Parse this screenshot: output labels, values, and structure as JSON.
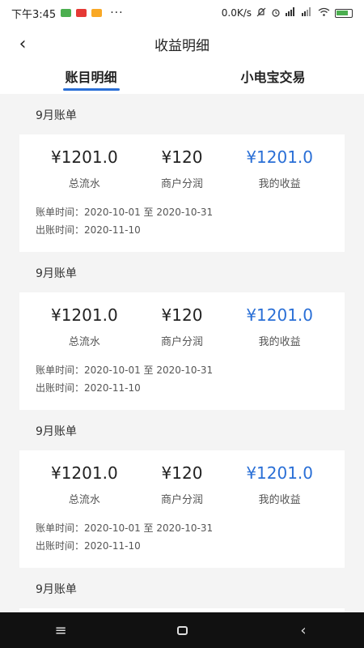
{
  "status_bar": {
    "time": "下午3:45",
    "dots": "···",
    "network_speed": "0.0K/s",
    "battery_level": 60,
    "icon_colors": [
      "#4caf50",
      "#e53935",
      "#f9a825"
    ]
  },
  "header": {
    "back_icon": "chevron-left-icon",
    "back_glyph": "‹",
    "title": "收益明细"
  },
  "tabs": [
    {
      "label": "账目明细",
      "active": true
    },
    {
      "label": "小电宝交易",
      "active": false
    }
  ],
  "sections": [
    {
      "title": "9月账单",
      "stats": [
        {
          "value": "¥1201.0",
          "label": "总流水"
        },
        {
          "value": "¥120",
          "label": "商户分润"
        },
        {
          "value": "¥1201.0",
          "label": "我的收益"
        }
      ],
      "bill_period": "账单时间：2020-10-01 至 2020-10-31",
      "bill_date": "出账时间：2020-11-10"
    },
    {
      "title": "9月账单",
      "stats": [
        {
          "value": "¥1201.0",
          "label": "总流水"
        },
        {
          "value": "¥120",
          "label": "商户分润"
        },
        {
          "value": "¥1201.0",
          "label": "我的收益"
        }
      ],
      "bill_period": "账单时间：2020-10-01 至 2020-10-31",
      "bill_date": "出账时间：2020-11-10"
    },
    {
      "title": "9月账单",
      "stats": [
        {
          "value": "¥1201.0",
          "label": "总流水"
        },
        {
          "value": "¥120",
          "label": "商户分润"
        },
        {
          "value": "¥1201.0",
          "label": "我的收益"
        }
      ],
      "bill_period": "账单时间：2020-10-01 至 2020-10-31",
      "bill_date": "出账时间：2020-11-10"
    },
    {
      "title": "9月账单"
    }
  ],
  "system_nav": {
    "menu_glyph": "≡",
    "back_glyph": "‹"
  },
  "colors": {
    "accent": "#2a6fd6"
  }
}
